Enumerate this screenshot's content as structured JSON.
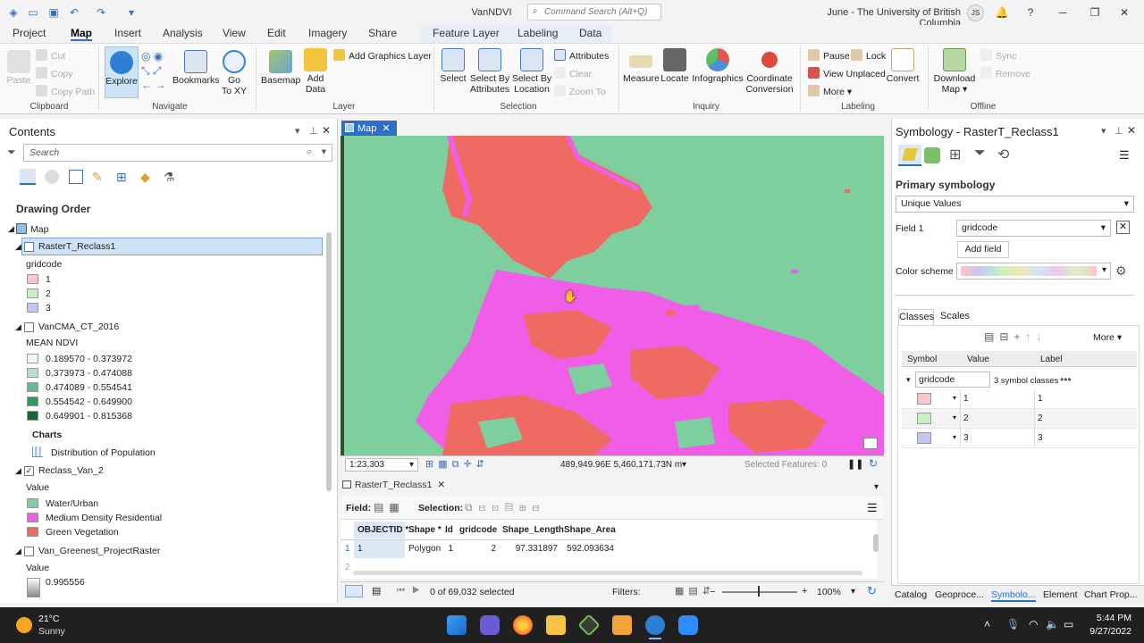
{
  "app": {
    "title": "VanNDVI",
    "command_search_placeholder": "Command Search (Alt+Q)",
    "user_org": "June - The University of British Columbia",
    "user_initials": "JS"
  },
  "tabs": [
    "Project",
    "Map",
    "Insert",
    "Analysis",
    "View",
    "Edit",
    "Imagery",
    "Share"
  ],
  "context_tabs": [
    "Feature Layer",
    "Labeling",
    "Data"
  ],
  "ribbon": {
    "paste": "Paste",
    "cut": "Cut",
    "copy": "Copy",
    "copy_path": "Copy Path",
    "clipboard": "Clipboard",
    "explore": "Explore",
    "bookmarks": "Bookmarks",
    "goto1": "Go",
    "goto2": "To XY",
    "navigate": "Navigate",
    "basemap": "Basemap",
    "add1": "Add",
    "add2": "Data",
    "add_graphics": "Add Graphics Layer",
    "layer": "Layer",
    "select": "Select",
    "sba1": "Select By",
    "sba2": "Attributes",
    "sbl1": "Select By",
    "sbl2": "Location",
    "attributes": "Attributes",
    "clear": "Clear",
    "zoom_to": "Zoom To",
    "selection": "Selection",
    "measure": "Measure",
    "locate": "Locate",
    "infographics": "Infographics",
    "coord1": "Coordinate",
    "coord2": "Conversion",
    "inquiry": "Inquiry",
    "pause": "Pause",
    "lock": "Lock",
    "view_unplaced": "View Unplaced",
    "more": "More",
    "convert": "Convert",
    "labeling": "Labeling",
    "dl1": "Download",
    "dl2": "Map",
    "sync": "Sync",
    "remove": "Remove",
    "offline": "Offline"
  },
  "contents": {
    "title": "Contents",
    "search_placeholder": "Search",
    "drawing_order": "Drawing Order",
    "map_label": "Map",
    "layers": [
      {
        "name": "RasterT_Reclass1",
        "field": "gridcode",
        "items": [
          {
            "label": "1",
            "color": "#f8c6cc"
          },
          {
            "label": "2",
            "color": "#c8f0c4"
          },
          {
            "label": "3",
            "color": "#c3c6f3"
          }
        ]
      },
      {
        "name": "VanCMA_CT_2016",
        "field": "MEAN NDVI",
        "items": [
          {
            "label": "0.189570 - 0.373972",
            "color": "#eef8f6"
          },
          {
            "label": "0.373973 - 0.474088",
            "color": "#b4e0d4"
          },
          {
            "label": "0.474089 - 0.554541",
            "color": "#62bb95"
          },
          {
            "label": "0.554542 - 0.649900",
            "color": "#2f9a5c"
          },
          {
            "label": "0.649901 - 0.815368",
            "color": "#0f6b2e"
          }
        ]
      },
      {
        "name": "Reclass_Van_2",
        "field": "Value",
        "items": [
          {
            "label": "Water/Urban",
            "color": "#7dcf9e"
          },
          {
            "label": "Medium Density Residential",
            "color": "#f05ee8"
          },
          {
            "label": "Green Vegetation",
            "color": "#ee6a63"
          }
        ]
      },
      {
        "name": "Van_Greenest_ProjectRaster",
        "field": "Value",
        "items": [
          {
            "label": "0.995556",
            "color": "#888888"
          }
        ]
      }
    ],
    "charts_label": "Charts",
    "chart_item": "Distribution of Population"
  },
  "map": {
    "tab": "Map",
    "scale": "1:23,303",
    "coords": "489,949.96E 5,460,171.73N m",
    "selected_features": "Selected Features: 0"
  },
  "attr": {
    "tab": "RasterT_Reclass1",
    "field_label": "Field:",
    "selection_label": "Selection:",
    "columns": [
      "OBJECTID *",
      "Shape *",
      "Id",
      "gridcode",
      "Shape_Length",
      "Shape_Area"
    ],
    "row1": [
      "1",
      "Polygon",
      "1",
      "2",
      "97.331897",
      "592.093634"
    ],
    "row_index": "1",
    "row2_index": "2",
    "selected": "0 of 69,032 selected",
    "filters": "Filters:",
    "zoom": "100%"
  },
  "symbology": {
    "title": "Symbology - RasterT_Reclass1",
    "primary": "Primary symbology",
    "method": "Unique Values",
    "field1_label": "Field 1",
    "field1_value": "gridcode",
    "add_field": "Add field",
    "color_scheme": "Color scheme",
    "tab_classes": "Classes",
    "tab_scales": "Scales",
    "more": "More",
    "hdr_symbol": "Symbol",
    "hdr_value": "Value",
    "hdr_label": "Label",
    "group_field": "gridcode",
    "group_count": "3 symbol classes",
    "classes": [
      {
        "value": "1",
        "label": "1",
        "color": "#f8c6cc"
      },
      {
        "value": "2",
        "label": "2",
        "color": "#c8f0c4"
      },
      {
        "value": "3",
        "label": "3",
        "color": "#c3c6f3"
      }
    ]
  },
  "bottom_tabs": [
    "Catalog",
    "Geoproce...",
    "Symbolo...",
    "Element",
    "Chart Prop..."
  ],
  "weather": {
    "temp": "21°C",
    "desc": "Sunny"
  },
  "clock": {
    "time": "5:44 PM",
    "date": "9/27/2022"
  }
}
